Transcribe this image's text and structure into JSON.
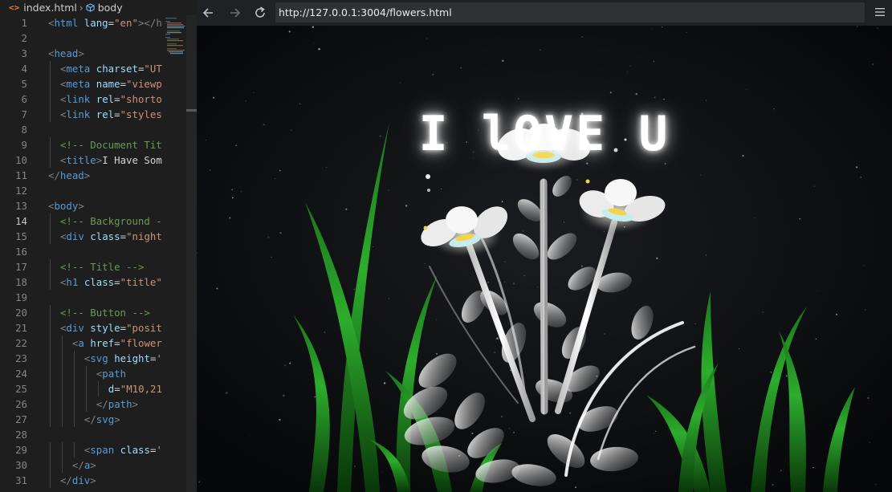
{
  "editor": {
    "breadcrumb": {
      "file": "index.html",
      "symbol": "body",
      "file_icon": "html-file-icon",
      "symbol_icon": "cube-icon"
    },
    "active_line": 14,
    "line_numbers": [
      "1",
      "2",
      "3",
      "4",
      "5",
      "6",
      "7",
      "8",
      "9",
      "10",
      "11",
      "12",
      "13",
      "14",
      "15",
      "16",
      "17",
      "18",
      "19",
      "20",
      "21",
      "22",
      "23",
      "24",
      "25",
      "26",
      "27",
      "28",
      "29",
      "30",
      "31"
    ],
    "lines": [
      {
        "n": 1,
        "indent": 0,
        "segs": [
          [
            "t",
            "<"
          ],
          [
            "tn",
            "html"
          ],
          [
            "tx",
            " "
          ],
          [
            "an",
            "lang"
          ],
          [
            "tx",
            "="
          ],
          [
            "av",
            "\"en\""
          ],
          [
            "t",
            ">"
          ],
          [
            "t",
            "</h"
          ]
        ]
      },
      {
        "n": 2,
        "indent": 0,
        "segs": []
      },
      {
        "n": 3,
        "indent": 0,
        "segs": [
          [
            "t",
            "<"
          ],
          [
            "tn",
            "head"
          ],
          [
            "t",
            ">"
          ]
        ]
      },
      {
        "n": 4,
        "indent": 1,
        "segs": [
          [
            "t",
            "<"
          ],
          [
            "tn",
            "meta"
          ],
          [
            "tx",
            " "
          ],
          [
            "an",
            "charset"
          ],
          [
            "tx",
            "="
          ],
          [
            "av",
            "\"UT"
          ]
        ]
      },
      {
        "n": 5,
        "indent": 1,
        "segs": [
          [
            "t",
            "<"
          ],
          [
            "tn",
            "meta"
          ],
          [
            "tx",
            " "
          ],
          [
            "an",
            "name"
          ],
          [
            "tx",
            "="
          ],
          [
            "av",
            "\"viewp"
          ]
        ]
      },
      {
        "n": 6,
        "indent": 1,
        "segs": [
          [
            "t",
            "<"
          ],
          [
            "tn",
            "link"
          ],
          [
            "tx",
            " "
          ],
          [
            "an",
            "rel"
          ],
          [
            "tx",
            "="
          ],
          [
            "av",
            "\"shorto"
          ]
        ]
      },
      {
        "n": 7,
        "indent": 1,
        "segs": [
          [
            "t",
            "<"
          ],
          [
            "tn",
            "link"
          ],
          [
            "tx",
            " "
          ],
          [
            "an",
            "rel"
          ],
          [
            "tx",
            "="
          ],
          [
            "av",
            "\"styles"
          ]
        ]
      },
      {
        "n": 8,
        "indent": 0,
        "segs": []
      },
      {
        "n": 9,
        "indent": 1,
        "segs": [
          [
            "cm",
            "<!-- Document Tit"
          ]
        ]
      },
      {
        "n": 10,
        "indent": 1,
        "segs": [
          [
            "t",
            "<"
          ],
          [
            "tn",
            "title"
          ],
          [
            "t",
            ">"
          ],
          [
            "tx",
            "I Have Som"
          ]
        ]
      },
      {
        "n": 11,
        "indent": 0,
        "segs": [
          [
            "t",
            "</"
          ],
          [
            "tn",
            "head"
          ],
          [
            "t",
            ">"
          ]
        ]
      },
      {
        "n": 12,
        "indent": 0,
        "segs": []
      },
      {
        "n": 13,
        "indent": 0,
        "segs": [
          [
            "t",
            "<"
          ],
          [
            "tn",
            "body"
          ],
          [
            "t",
            ">"
          ]
        ]
      },
      {
        "n": 14,
        "indent": 1,
        "segs": [
          [
            "cm",
            "<!-- Background -"
          ]
        ]
      },
      {
        "n": 15,
        "indent": 1,
        "segs": [
          [
            "t",
            "<"
          ],
          [
            "tn",
            "div"
          ],
          [
            "tx",
            " "
          ],
          [
            "an",
            "class"
          ],
          [
            "tx",
            "="
          ],
          [
            "av",
            "\"night"
          ]
        ]
      },
      {
        "n": 16,
        "indent": 0,
        "segs": []
      },
      {
        "n": 17,
        "indent": 1,
        "segs": [
          [
            "cm",
            "<!-- Title -->"
          ]
        ]
      },
      {
        "n": 18,
        "indent": 1,
        "segs": [
          [
            "t",
            "<"
          ],
          [
            "tn",
            "h1"
          ],
          [
            "tx",
            " "
          ],
          [
            "an",
            "class"
          ],
          [
            "tx",
            "="
          ],
          [
            "av",
            "\"title\""
          ]
        ]
      },
      {
        "n": 19,
        "indent": 0,
        "segs": []
      },
      {
        "n": 20,
        "indent": 1,
        "segs": [
          [
            "cm",
            "<!-- Button -->"
          ]
        ]
      },
      {
        "n": 21,
        "indent": 1,
        "segs": [
          [
            "t",
            "<"
          ],
          [
            "tn",
            "div"
          ],
          [
            "tx",
            " "
          ],
          [
            "an",
            "style"
          ],
          [
            "tx",
            "="
          ],
          [
            "av",
            "\"posit"
          ]
        ]
      },
      {
        "n": 22,
        "indent": 2,
        "segs": [
          [
            "t",
            "<"
          ],
          [
            "tn",
            "a"
          ],
          [
            "tx",
            " "
          ],
          [
            "an",
            "href"
          ],
          [
            "tx",
            "="
          ],
          [
            "av",
            "\"flower"
          ]
        ]
      },
      {
        "n": 23,
        "indent": 3,
        "segs": [
          [
            "t",
            "<"
          ],
          [
            "tn",
            "svg"
          ],
          [
            "tx",
            " "
          ],
          [
            "an",
            "height"
          ],
          [
            "tx",
            "="
          ],
          [
            "av",
            "'"
          ]
        ]
      },
      {
        "n": 24,
        "indent": 4,
        "segs": [
          [
            "t",
            "<"
          ],
          [
            "tn",
            "path"
          ]
        ]
      },
      {
        "n": 25,
        "indent": 5,
        "segs": [
          [
            "an",
            "d"
          ],
          [
            "tx",
            "="
          ],
          [
            "av",
            "\"M10,21"
          ]
        ]
      },
      {
        "n": 26,
        "indent": 4,
        "segs": [
          [
            "t",
            "</"
          ],
          [
            "tn",
            "path"
          ],
          [
            "t",
            ">"
          ]
        ]
      },
      {
        "n": 27,
        "indent": 3,
        "segs": [
          [
            "t",
            "</"
          ],
          [
            "tn",
            "svg"
          ],
          [
            "t",
            ">"
          ]
        ]
      },
      {
        "n": 28,
        "indent": 0,
        "segs": []
      },
      {
        "n": 29,
        "indent": 3,
        "segs": [
          [
            "t",
            "<"
          ],
          [
            "tn",
            "span"
          ],
          [
            "tx",
            " "
          ],
          [
            "an",
            "class"
          ],
          [
            "tx",
            "="
          ],
          [
            "av",
            "'"
          ]
        ]
      },
      {
        "n": 30,
        "indent": 2,
        "segs": [
          [
            "t",
            "</"
          ],
          [
            "tn",
            "a"
          ],
          [
            "t",
            ">"
          ]
        ]
      },
      {
        "n": 31,
        "indent": 1,
        "segs": [
          [
            "t",
            "</"
          ],
          [
            "tn",
            "div"
          ],
          [
            "t",
            ">"
          ]
        ]
      }
    ]
  },
  "browser": {
    "url": "http://127.0.0.1:3004/flowers.html",
    "back_icon": "arrow-left-icon",
    "forward_icon": "arrow-right-icon",
    "reload_icon": "reload-icon",
    "menu_icon": "hamburger-menu-icon",
    "page": {
      "title": "I lOVE U",
      "colors": {
        "background": "#0b0d0f",
        "grass": "#2fb62f",
        "petal": "#ffffff",
        "flower_center": "#f5d547"
      }
    }
  }
}
